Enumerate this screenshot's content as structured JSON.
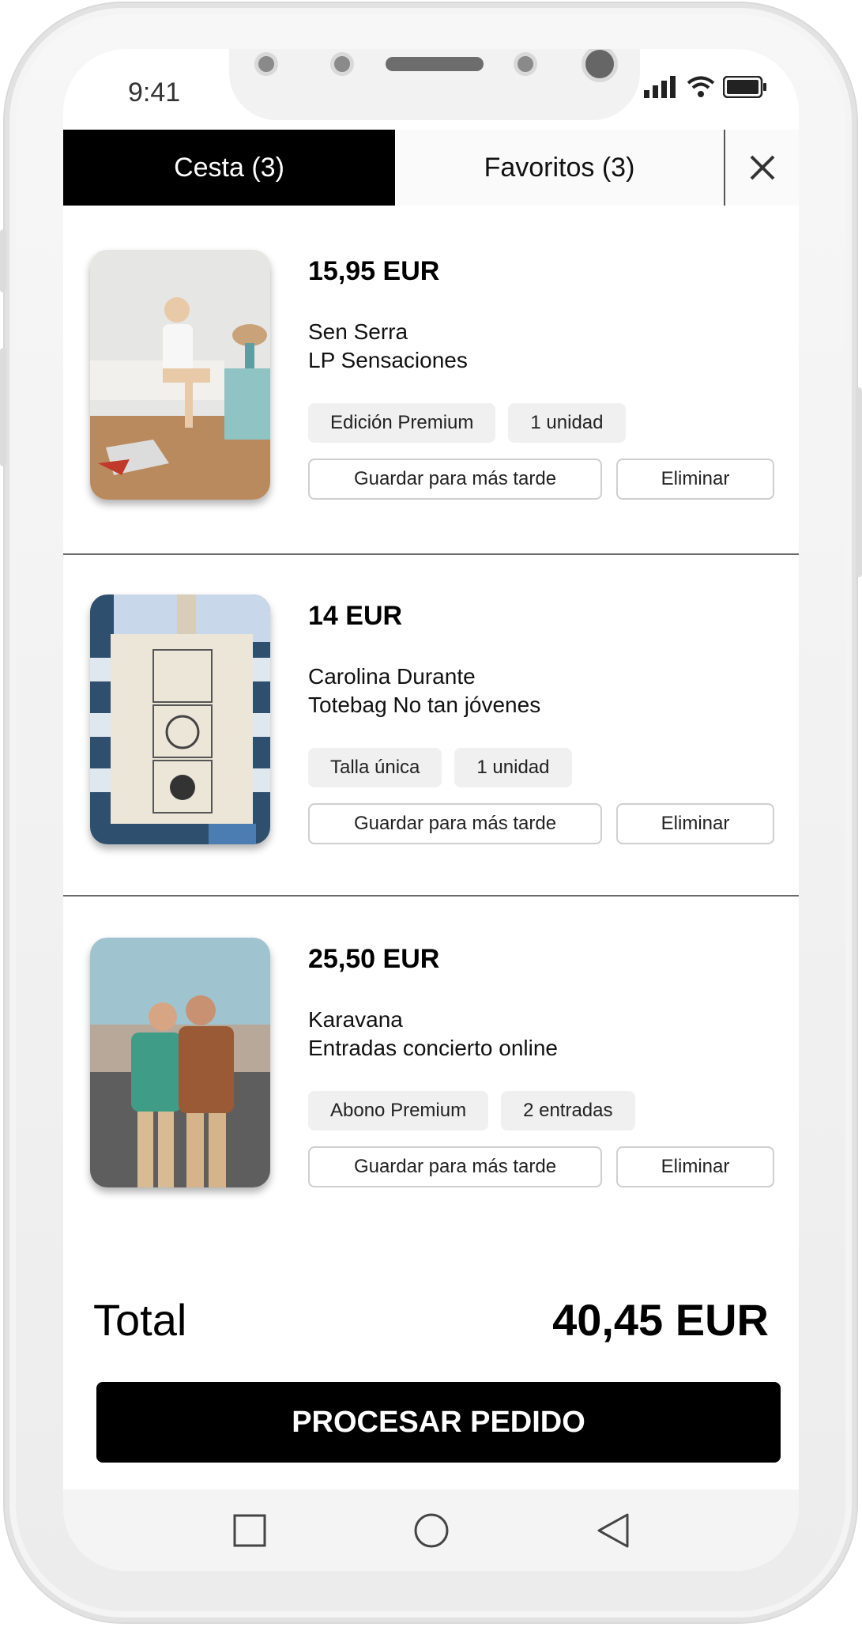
{
  "status_bar": {
    "time": "9:41"
  },
  "tabs": {
    "cart_label": "Cesta (3)",
    "favorites_label": "Favoritos (3)",
    "close_icon": "close-icon"
  },
  "items": [
    {
      "price": "15,95 EUR",
      "artist": "Sen Serra",
      "product": "LP Sensaciones",
      "variant": "Edición Premium",
      "quantity": "1 unidad",
      "save_label": "Guardar para más tarde",
      "delete_label": "Eliminar"
    },
    {
      "price": "14 EUR",
      "artist": "Carolina Durante",
      "product": "Totebag No tan jóvenes",
      "variant": "Talla única",
      "quantity": "1 unidad",
      "save_label": "Guardar para más tarde",
      "delete_label": "Eliminar"
    },
    {
      "price": "25,50 EUR",
      "artist": "Karavana",
      "product": "Entradas concierto online",
      "variant": "Abono Premium",
      "quantity": "2 entradas",
      "save_label": "Guardar para más tarde",
      "delete_label": "Eliminar"
    }
  ],
  "summary": {
    "total_label": "Total",
    "total_value": "40,45 EUR"
  },
  "checkout": {
    "label": "PROCESAR PEDIDO"
  },
  "nav": {
    "recents_icon": "square-icon",
    "home_icon": "circle-icon",
    "back_icon": "triangle-back-icon"
  },
  "colors": {
    "primary": "#000000",
    "chip_bg": "#f0f0f0",
    "divider": "#6a6a6a"
  }
}
